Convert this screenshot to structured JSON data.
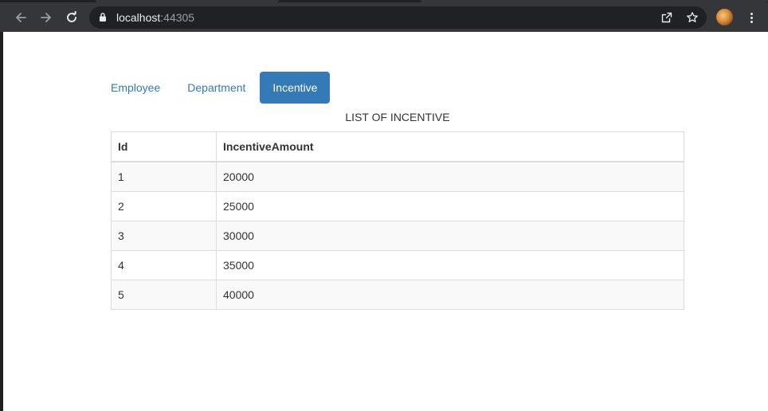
{
  "browser": {
    "url_host": "localhost",
    "url_port": ":44305",
    "icons": [
      "back-arrow-icon",
      "forward-arrow-icon",
      "reload-icon",
      "lock-icon",
      "share-icon",
      "star-icon",
      "profile-avatar",
      "more-vert-icon"
    ]
  },
  "nav": {
    "tabs": [
      {
        "label": "Employee",
        "active": false
      },
      {
        "label": "Department",
        "active": false
      },
      {
        "label": "Incentive",
        "active": true
      }
    ],
    "active_color": "#337ab7"
  },
  "main": {
    "title": "LIST OF INCENTIVE",
    "table": {
      "headers": [
        "Id",
        "IncentiveAmount"
      ],
      "rows": [
        [
          "1",
          "20000"
        ],
        [
          "2",
          "25000"
        ],
        [
          "3",
          "30000"
        ],
        [
          "4",
          "35000"
        ],
        [
          "5",
          "40000"
        ]
      ]
    }
  }
}
